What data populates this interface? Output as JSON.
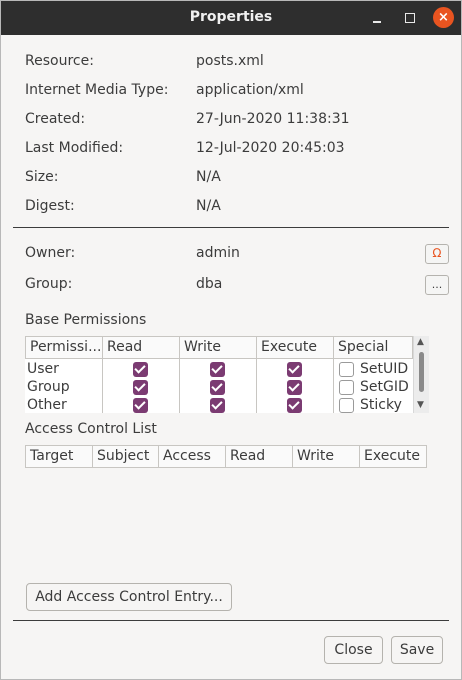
{
  "window": {
    "title": "Properties",
    "close_glyph": "×"
  },
  "info": [
    {
      "label": "Resource:",
      "value": "posts.xml"
    },
    {
      "label": "Internet Media Type:",
      "value": "application/xml"
    },
    {
      "label": "Created:",
      "value": "27-Jun-2020 11:38:31"
    },
    {
      "label": "Last Modified:",
      "value": "12-Jul-2020 20:45:03"
    },
    {
      "label": "Size:",
      "value": "N/A"
    },
    {
      "label": "Digest:",
      "value": "N/A"
    }
  ],
  "ownership": {
    "owner_label": "Owner:",
    "owner_value": "admin",
    "owner_button_icon": "user-icon",
    "group_label": "Group:",
    "group_value": "dba",
    "group_button": "..."
  },
  "base_permissions": {
    "title": "Base Permissions",
    "columns": [
      "Permissi...",
      "Read",
      "Write",
      "Execute",
      "Special"
    ],
    "rows": [
      {
        "name": "User",
        "read": true,
        "write": true,
        "execute": true,
        "special": "SetUID",
        "special_checked": false
      },
      {
        "name": "Group",
        "read": true,
        "write": true,
        "execute": true,
        "special": "SetGID",
        "special_checked": false
      },
      {
        "name": "Other",
        "read": true,
        "write": true,
        "execute": true,
        "special": "Sticky",
        "special_checked": false
      }
    ]
  },
  "acl": {
    "title": "Access Control List",
    "columns": [
      "Target",
      "Subject",
      "Access",
      "Read",
      "Write",
      "Execute"
    ],
    "add_button": "Add Access Control Entry..."
  },
  "footer": {
    "close_label": "Close",
    "save_label": "Save"
  },
  "colors": {
    "titlebar": "#2e2e2e",
    "close_button": "#e95420",
    "checkbox": "#7b3b72"
  }
}
